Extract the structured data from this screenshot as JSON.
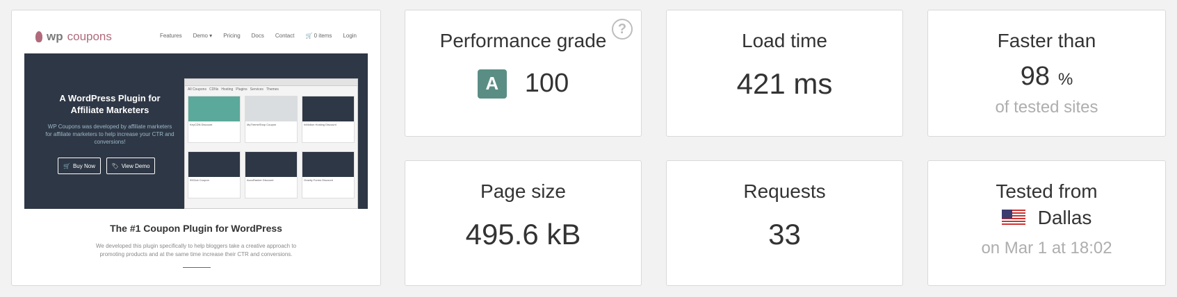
{
  "screenshot": {
    "logo_wp": "wp",
    "logo_coupons": "coupons",
    "menu": [
      "Features",
      "Demo ▾",
      "Pricing",
      "Docs",
      "Contact",
      "🛒 0 items",
      "Login"
    ],
    "hero_title": "A WordPress Plugin for Affiliate Marketers",
    "hero_text": "WP Coupons was developed by affiliate marketers for affiliate marketers to help increase your CTR and conversions!",
    "buy_now": "Buy Now",
    "view_demo": "View Demo",
    "browser_tabs": [
      "All Coupons",
      "CDNs",
      "Hosting",
      "Plugins",
      "Services",
      "Themes"
    ],
    "tiles": [
      {
        "name": "KeyCDN Discount",
        "color": "#5ba99b"
      },
      {
        "name": "MyThemeShop Coupon",
        "color": "#d9dde0"
      },
      {
        "name": "InMotion Hosting Discount",
        "color": "#2e3745"
      },
      {
        "name": "99Club Coupon",
        "color": "#2e3745"
      },
      {
        "name": "AccuRanker Discount",
        "color": "#2e3745"
      },
      {
        "name": "Gravity Forms Discount",
        "color": "#2e3745"
      }
    ],
    "heading": "The #1 Coupon Plugin for WordPress",
    "paragraph": "We developed this plugin specifically to help bloggers take a creative approach to promoting products and at the same time increase their CTR and conversions."
  },
  "metrics": {
    "performance": {
      "label": "Performance grade",
      "grade": "A",
      "value": "100",
      "help": "?"
    },
    "load_time": {
      "label": "Load time",
      "value": "421 ms"
    },
    "faster_than": {
      "label": "Faster than",
      "value": "98",
      "unit": "%",
      "sub": "of tested sites"
    },
    "page_size": {
      "label": "Page size",
      "value": "495.6 kB"
    },
    "requests": {
      "label": "Requests",
      "value": "33"
    },
    "tested_from": {
      "label": "Tested from",
      "city": "Dallas",
      "sub": "on Mar 1 at 18:02",
      "flag": "us-flag-icon"
    }
  },
  "colors": {
    "grade_bg": "#5a8e85",
    "hero_bg": "#2e3745",
    "brand": "#b06a7c"
  }
}
